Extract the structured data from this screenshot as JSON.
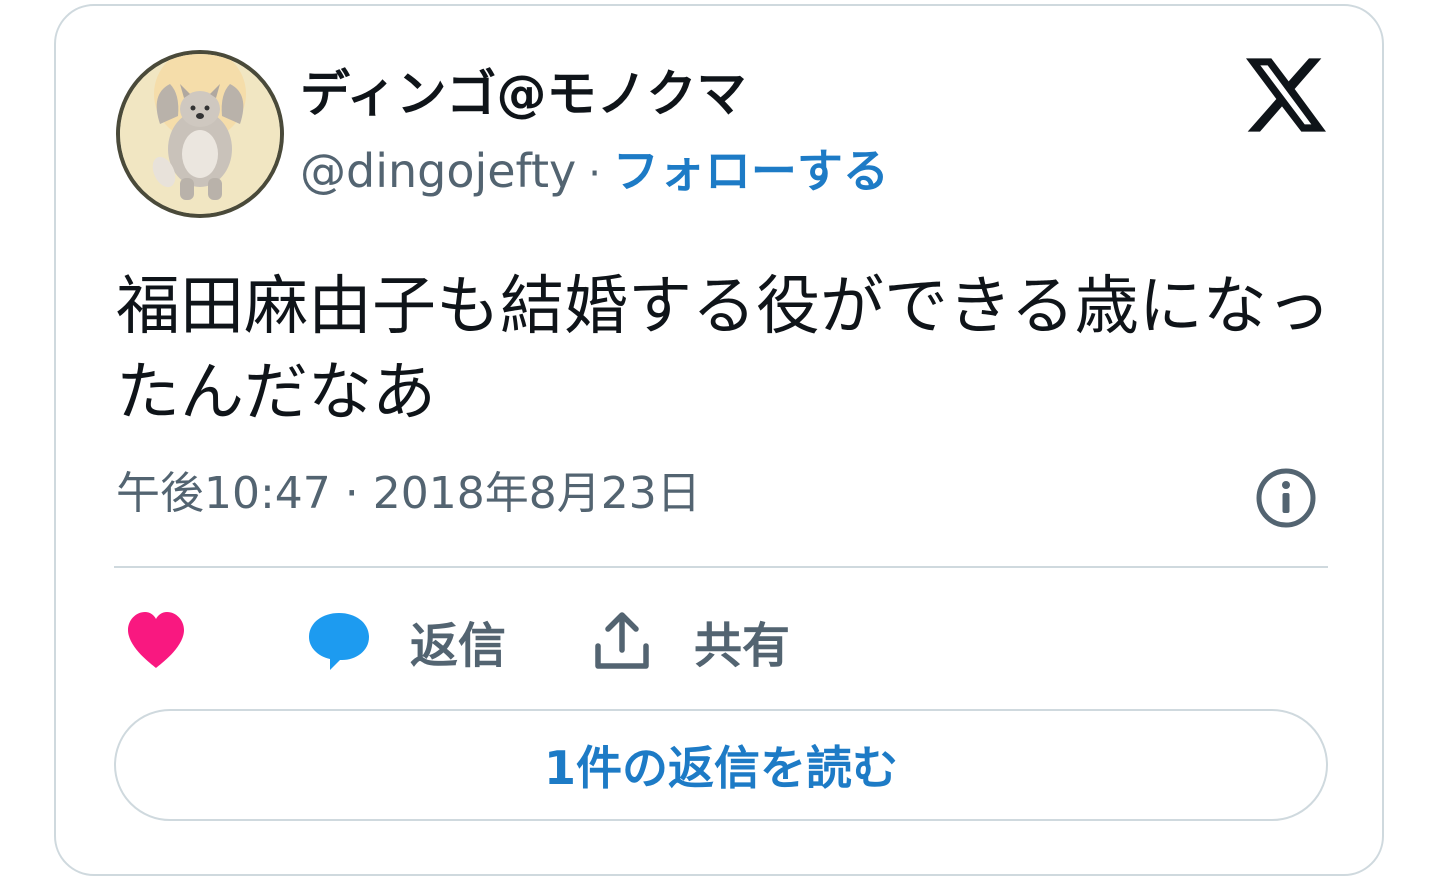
{
  "author": {
    "display_name": "ディンゴ@モノクマ",
    "handle": "@dingojefty",
    "separator": "·",
    "follow_label": "フォローする"
  },
  "tweet": {
    "text": "福田麻由子も結婚する役ができる歳になったんだなあ",
    "timestamp": "午後10:47 · 2018年8月23日"
  },
  "actions": {
    "reply_label": "返信",
    "share_label": "共有",
    "read_replies_label": "1件の返信を読む"
  },
  "icons": {
    "avatar": "avatar-image",
    "brand": "x-logo-icon",
    "info": "info-icon",
    "like": "heart-icon",
    "reply": "speech-bubble-icon",
    "share": "upload-share-icon"
  },
  "colors": {
    "accent": "#1d7bc6",
    "like": "#f91880",
    "reply": "#1d9bf0",
    "text": "#0f1419",
    "secondary": "#536471",
    "border": "#cfd9de"
  }
}
